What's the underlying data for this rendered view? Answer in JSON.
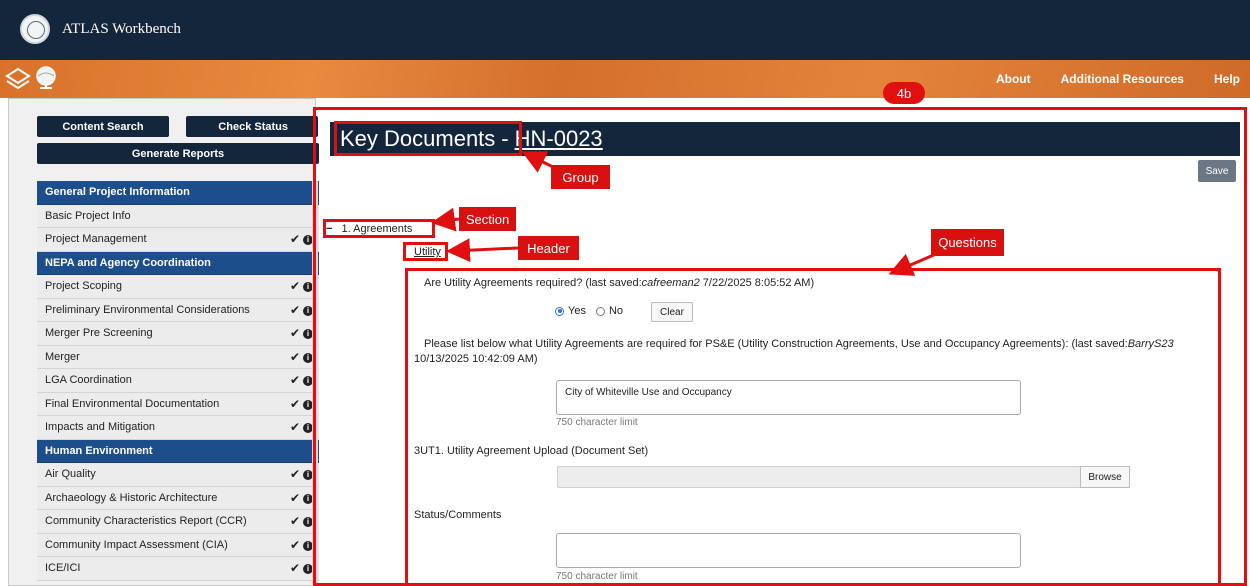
{
  "app": {
    "title": "ATLAS Workbench",
    "icons": [
      "seal-icon",
      "layers-icon",
      "globe-icon"
    ]
  },
  "nav": {
    "links": [
      "About",
      "Additional Resources",
      "Help"
    ]
  },
  "sidebar": {
    "buttons": {
      "content_search": "Content Search",
      "check_status": "Check Status",
      "generate_reports": "Generate Reports"
    },
    "items": [
      {
        "label": "General Project Information",
        "header": true
      },
      {
        "label": "Basic Project Info",
        "marks": false
      },
      {
        "label": "Project Management",
        "marks": true
      },
      {
        "label": "NEPA and Agency Coordination",
        "header": true
      },
      {
        "label": "Project Scoping",
        "marks": true
      },
      {
        "label": "Preliminary Environmental Considerations",
        "marks": true
      },
      {
        "label": "Merger Pre Screening",
        "marks": true
      },
      {
        "label": "Merger",
        "marks": true
      },
      {
        "label": "LGA Coordination",
        "marks": true
      },
      {
        "label": "Final Environmental Documentation",
        "marks": true
      },
      {
        "label": "Impacts and Mitigation",
        "marks": true
      },
      {
        "label": "Human Environment",
        "header": true
      },
      {
        "label": "Air Quality",
        "marks": true
      },
      {
        "label": "Archaeology & Historic Architecture",
        "marks": true
      },
      {
        "label": "Community Characteristics Report (CCR)",
        "marks": true
      },
      {
        "label": "Community Impact Assessment (CIA)",
        "marks": true
      },
      {
        "label": "ICE/ICI",
        "marks": true
      }
    ],
    "check_glyph": "✔",
    "info_glyph": "i"
  },
  "main": {
    "group_title": "Key Documents",
    "separator": "-",
    "project_id": "HN-0023",
    "save_label": "Save",
    "section": {
      "toggle": "−",
      "label": "1. Agreements"
    },
    "header_label": "Utility",
    "questions": {
      "q1_text": "Are Utility Agreements required?  (last saved:",
      "q1_user": "cafreeman2",
      "q1_time": " 7/22/2025 8:05:52 AM)",
      "yes_label": "Yes",
      "no_label": "No",
      "clear_label": "Clear",
      "q2_text_a": "Please list below what Utility Agreements are required for PS&E (Utility Construction Agreements, Use and Occupancy Agreements): (last saved:",
      "q2_user": "BarryS23",
      "q2_text_b": "10/13/2025 10:42:09 AM)",
      "q2_value": "City of Whiteville Use and Occupancy",
      "char_limit": "750 character limit",
      "q3_text": "3UT1. Utility Agreement Upload (Document Set)",
      "browse_label": "Browse",
      "q4_text": "Status/Comments",
      "q4_value": "",
      "char_limit2": "750 character limit"
    }
  },
  "annotations": {
    "badge": "4b",
    "group": "Group",
    "section": "Section",
    "header": "Header",
    "questions": "Questions",
    "color": "#e01010"
  }
}
